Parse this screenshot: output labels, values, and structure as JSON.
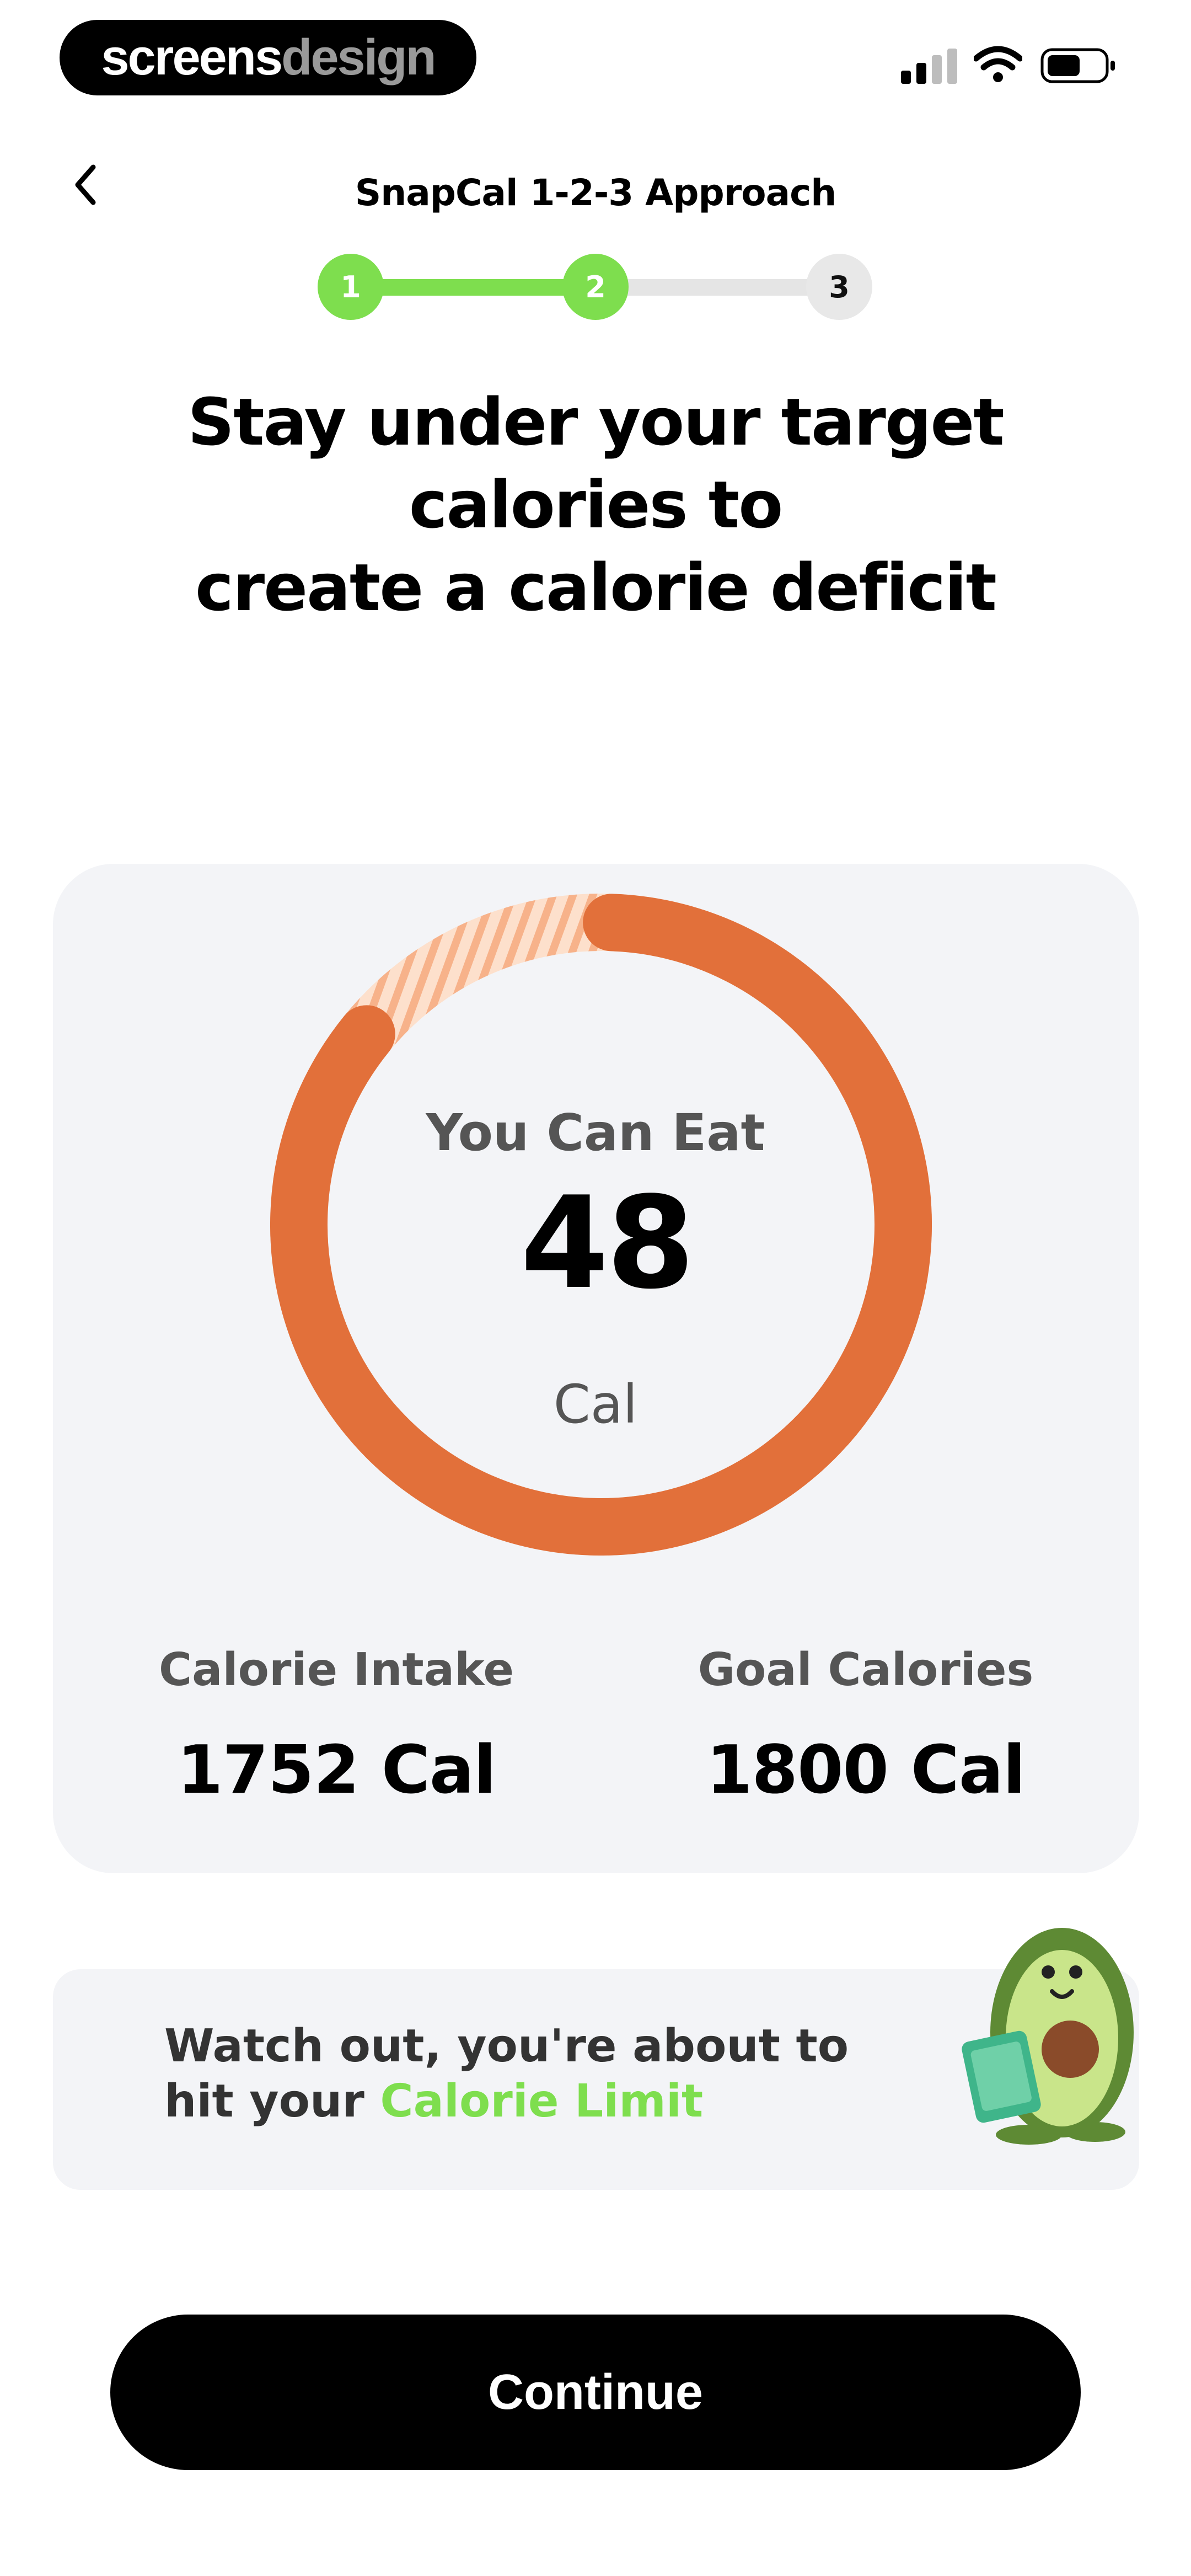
{
  "status_bar": {
    "brand_part1": "screens",
    "brand_part2": "design",
    "icons": [
      "signal-icon",
      "wifi-icon",
      "battery-icon"
    ]
  },
  "header": {
    "back_icon": "chevron-left-icon",
    "title": "SnapCal 1-2-3 Approach"
  },
  "stepper": {
    "steps": [
      {
        "label": "1",
        "state": "done"
      },
      {
        "label": "2",
        "state": "current"
      },
      {
        "label": "3",
        "state": "todo"
      }
    ],
    "progress_fraction": 0.5
  },
  "headline_line1": "Stay under your target calories to",
  "headline_line2": "create a calorie deficit",
  "summary_card": {
    "ring_label": "You Can Eat",
    "ring_value": "48",
    "ring_unit": "Cal",
    "ring_fill_fraction": 0.973,
    "intake_label": "Calorie Intake",
    "intake_value": "1752 Cal",
    "goal_label": "Goal Calories",
    "goal_value": "1800 Cal"
  },
  "warning": {
    "text_before": "Watch out, you're about to hit your ",
    "text_highlight": "Calorie Limit",
    "mascot_icon": "avocado-mascot-icon"
  },
  "continue_label": "Continue",
  "colors": {
    "accent_green": "#7ede4e",
    "ring_orange": "#e2703a",
    "card_bg": "#f3f4f7",
    "button_bg": "#000000"
  }
}
